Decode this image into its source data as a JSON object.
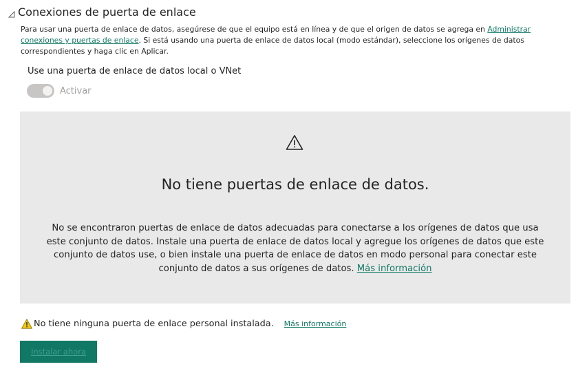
{
  "section": {
    "title": "Conexiones de puerta de enlace",
    "collapse_icon": "collapse-triangle-icon"
  },
  "intro": {
    "text_before": "Para usar una puerta de enlace de datos, asegúrese de que el equipo está en línea y de que el origen de datos se agrega en ",
    "link": "Administrar conexiones y puertas de enlace",
    "text_after": ". Si está usando una puerta de enlace de datos local (modo estándar), seleccione los orígenes de datos correspondientes y haga clic en Aplicar."
  },
  "gateway": {
    "label": "Use una puerta de enlace de datos local o VNet",
    "toggle_label": "Activar",
    "toggle_on": true,
    "toggle_disabled": true
  },
  "empty_state": {
    "icon": "warning-icon",
    "title": "No tiene puertas de enlace de datos.",
    "body": "No se encontraron puertas de enlace de datos adecuadas para conectarse a los orígenes de datos que usa este conjunto de datos. Instale una puerta de enlace de datos local y agregue los orígenes de datos que este conjunto de datos use, o bien instale una puerta de enlace de datos en modo personal para conectar este conjunto de datos a sus orígenes de datos. ",
    "link": "Más información"
  },
  "personal_gateway": {
    "icon": "warning-icon",
    "text": "No tiene ninguna puerta de enlace personal instalada.",
    "link": "Más información"
  },
  "install_button": {
    "label": "Instalar ahora"
  },
  "colors": {
    "accent": "#117865",
    "panel_background": "#e9e9e9",
    "warning_yellow": "#f2c811",
    "toggle_disabled": "#c8c6c4"
  }
}
